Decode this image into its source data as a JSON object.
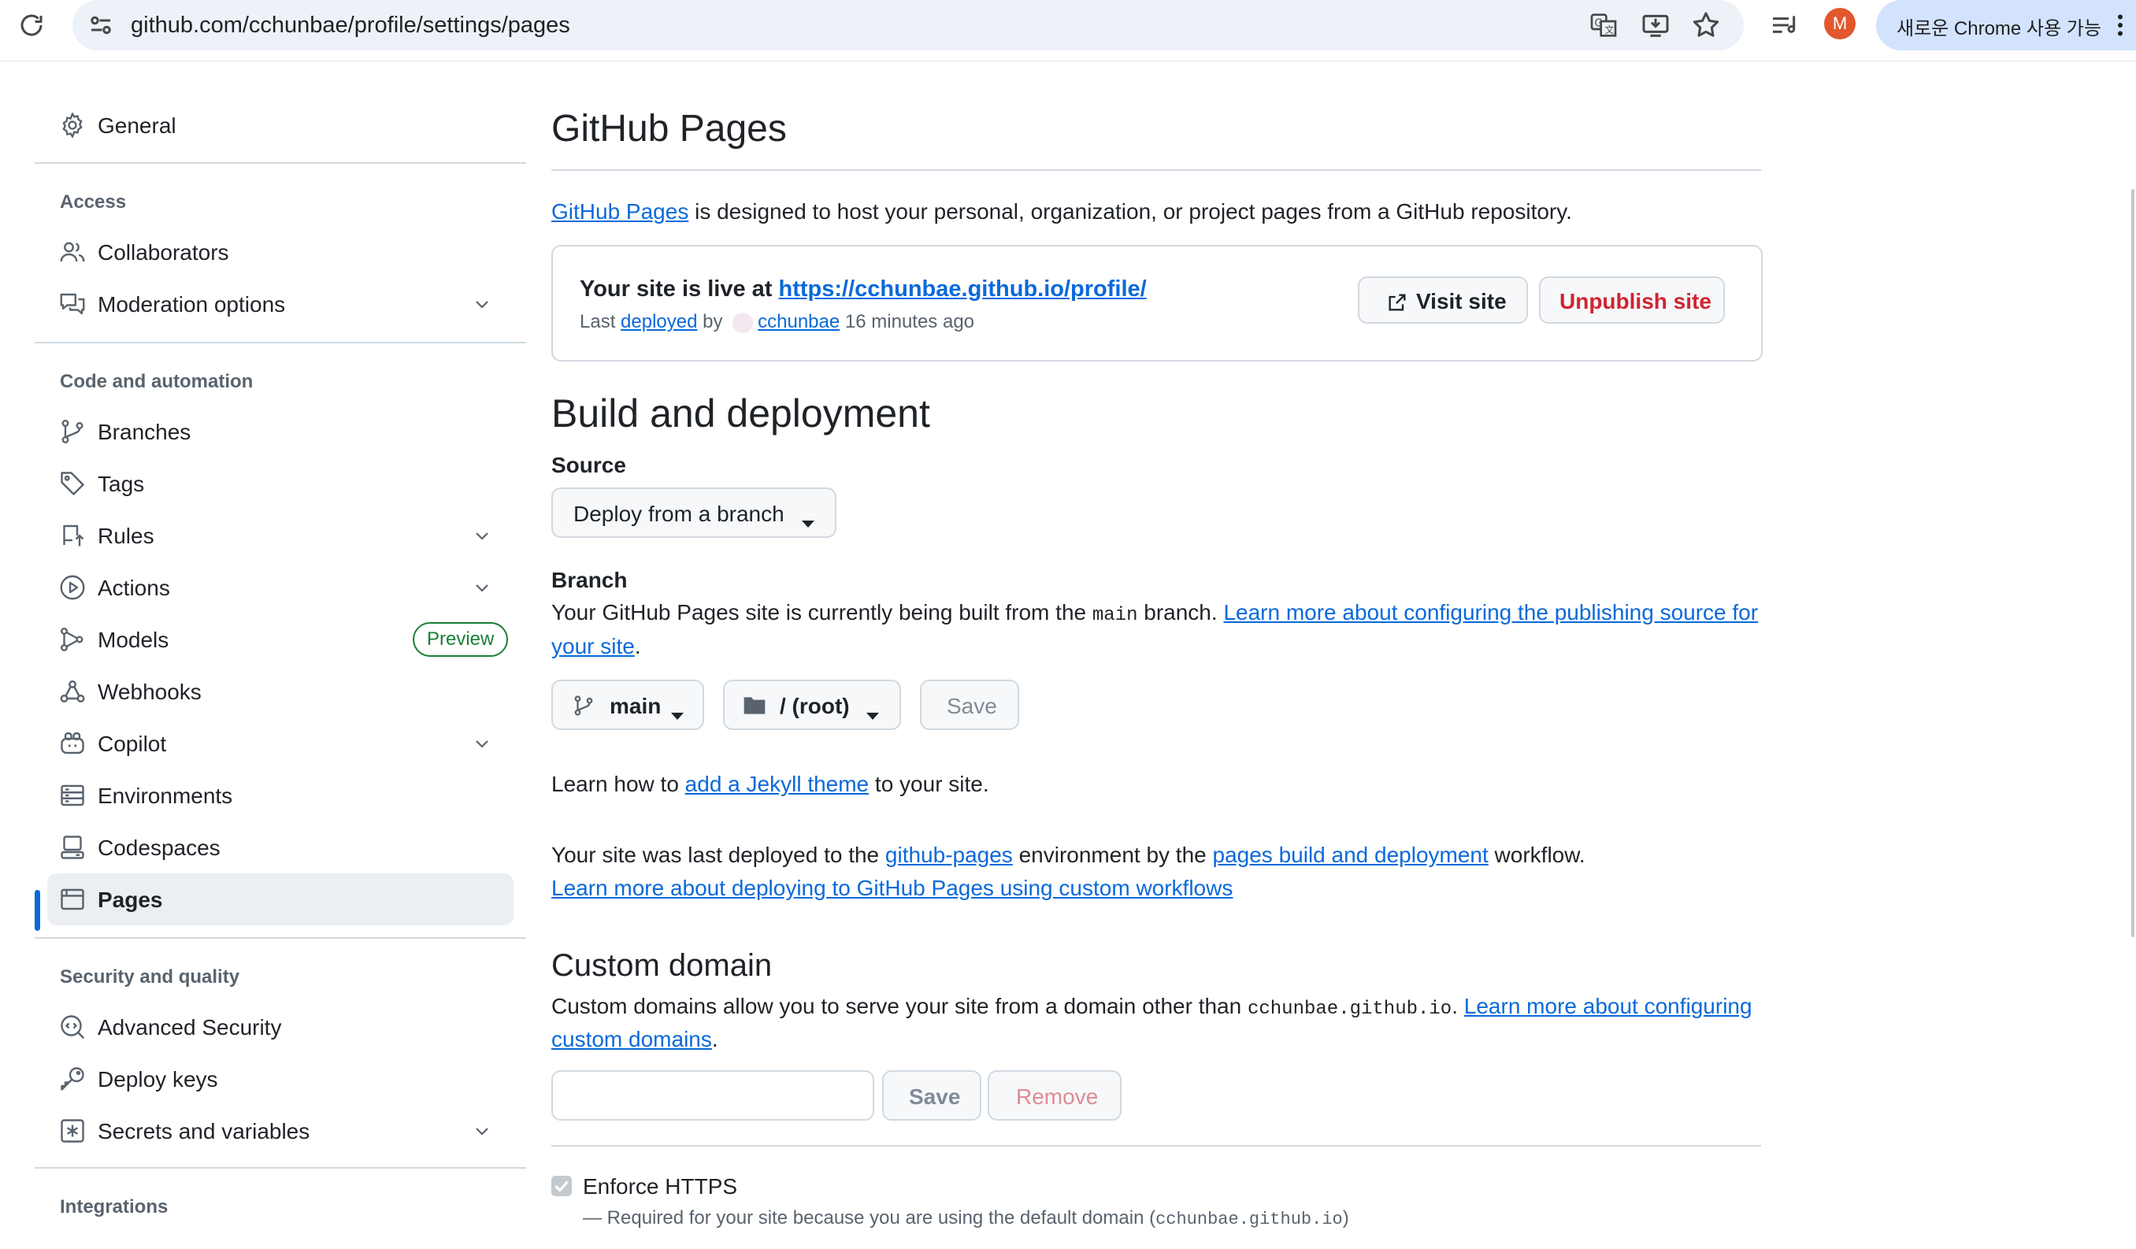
{
  "browser": {
    "url": "github.com/cchunbae/profile/settings/pages",
    "profile_initial": "M",
    "chrome_pill": "새로운 Chrome 사용 가능"
  },
  "sidebar": {
    "general": "General",
    "access_header": "Access",
    "collaborators": "Collaborators",
    "moderation": "Moderation options",
    "code_header": "Code and automation",
    "branches": "Branches",
    "tags": "Tags",
    "rules": "Rules",
    "actions": "Actions",
    "models": "Models",
    "models_badge": "Preview",
    "webhooks": "Webhooks",
    "copilot": "Copilot",
    "environments": "Environments",
    "codespaces": "Codespaces",
    "pages": "Pages",
    "security_header": "Security and quality",
    "advanced_security": "Advanced Security",
    "deploy_keys": "Deploy keys",
    "secrets": "Secrets and variables",
    "integrations_header": "Integrations"
  },
  "main": {
    "title": "GitHub Pages",
    "intro_link": "GitHub Pages",
    "intro_rest": " is designed to host your personal, organization, or project pages from a GitHub repository.",
    "live_prefix": "Your site is live at ",
    "live_url": "https://cchunbae.github.io/profile/",
    "last_prefix": "Last ",
    "deployed_link": "deployed",
    "by": " by ",
    "deployer": "cchunbae",
    "ago": " 16 minutes ago",
    "visit_site": "Visit site",
    "unpublish": "Unpublish site",
    "build_title": "Build and deployment",
    "source_label": "Source",
    "source_value": "Deploy from a branch",
    "branch_label": "Branch",
    "branch_desc_1": "Your GitHub Pages site is currently being built from the ",
    "branch_desc_code": "main",
    "branch_desc_2": " branch. ",
    "branch_link_1": "Learn more about configuring the publishing source for",
    "branch_link_2": "your site",
    "branch_desc_end": ".",
    "branch_select": "main",
    "folder_select": "/ (root)",
    "save": "Save",
    "jekyll_1": "Learn how to ",
    "jekyll_link": "add a Jekyll theme",
    "jekyll_2": " to your site.",
    "deployed_1": "Your site was last deployed to the ",
    "env_link": "github-pages",
    "deployed_2": " environment by the ",
    "workflow_link": "pages build and deployment",
    "deployed_3": " workflow.",
    "custom_workflows_link": "Learn more about deploying to GitHub Pages using custom workflows",
    "custom_domain_title": "Custom domain",
    "cd_desc_1": "Custom domains allow you to serve your site from a domain other than ",
    "cd_code": "cchunbae.github.io",
    "cd_desc_2": ". ",
    "cd_link_1": "Learn more about configuring",
    "cd_link_2": "custom domains",
    "cd_end": ".",
    "domain_placeholder": "",
    "save2": "Save",
    "remove": "Remove",
    "https_label": "Enforce HTTPS",
    "https_note_1": "— Required for your site because you are using the default domain (",
    "https_note_code": "cchunbae.github.io",
    "https_note_2": ")"
  }
}
